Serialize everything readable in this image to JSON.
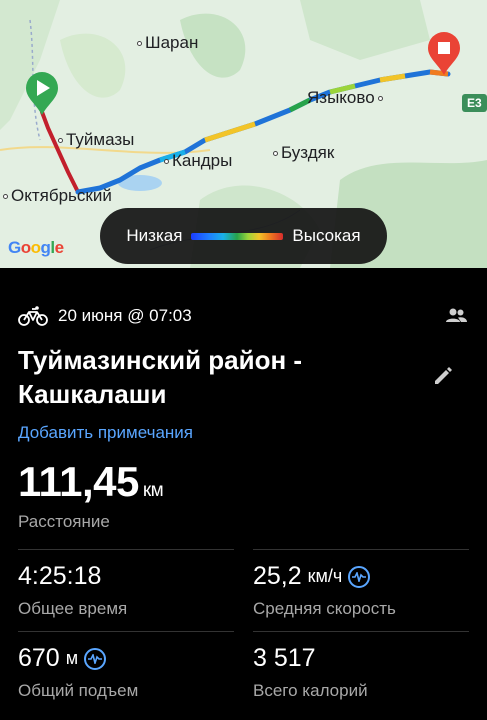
{
  "map": {
    "places": {
      "sharan": "Шаран",
      "yazykovo": "Языково",
      "tuymazy": "Туймазы",
      "kandry": "Кандры",
      "buzdyak": "Буздяк",
      "oktyabrsky": "Октябрьский"
    },
    "road_badge": "E3",
    "google_letters": [
      "G",
      "o",
      "o",
      "g",
      "l",
      "e"
    ],
    "legend": {
      "low": "Низкая",
      "high": "Высокая"
    },
    "start_color": "#34a853",
    "end_color": "#ea4335"
  },
  "activity": {
    "date": "20 июня @ 07:03",
    "title": "Туймазинский район - Кашкалаши",
    "add_note": "Добавить примечания",
    "distance": {
      "value": "111,45",
      "unit": "км",
      "label": "Расстояние"
    },
    "stats": {
      "total_time": {
        "value": "4:25:18",
        "unit": "",
        "label": "Общее время"
      },
      "avg_speed": {
        "value": "25,2",
        "unit": "км/ч",
        "label": "Средняя скорость"
      },
      "ascent": {
        "value": "670",
        "unit": "м",
        "label": "Общий подъем"
      },
      "calories": {
        "value": "3 517",
        "unit": "",
        "label": "Всего калорий"
      }
    },
    "accent_color": "#5aa6ff"
  }
}
